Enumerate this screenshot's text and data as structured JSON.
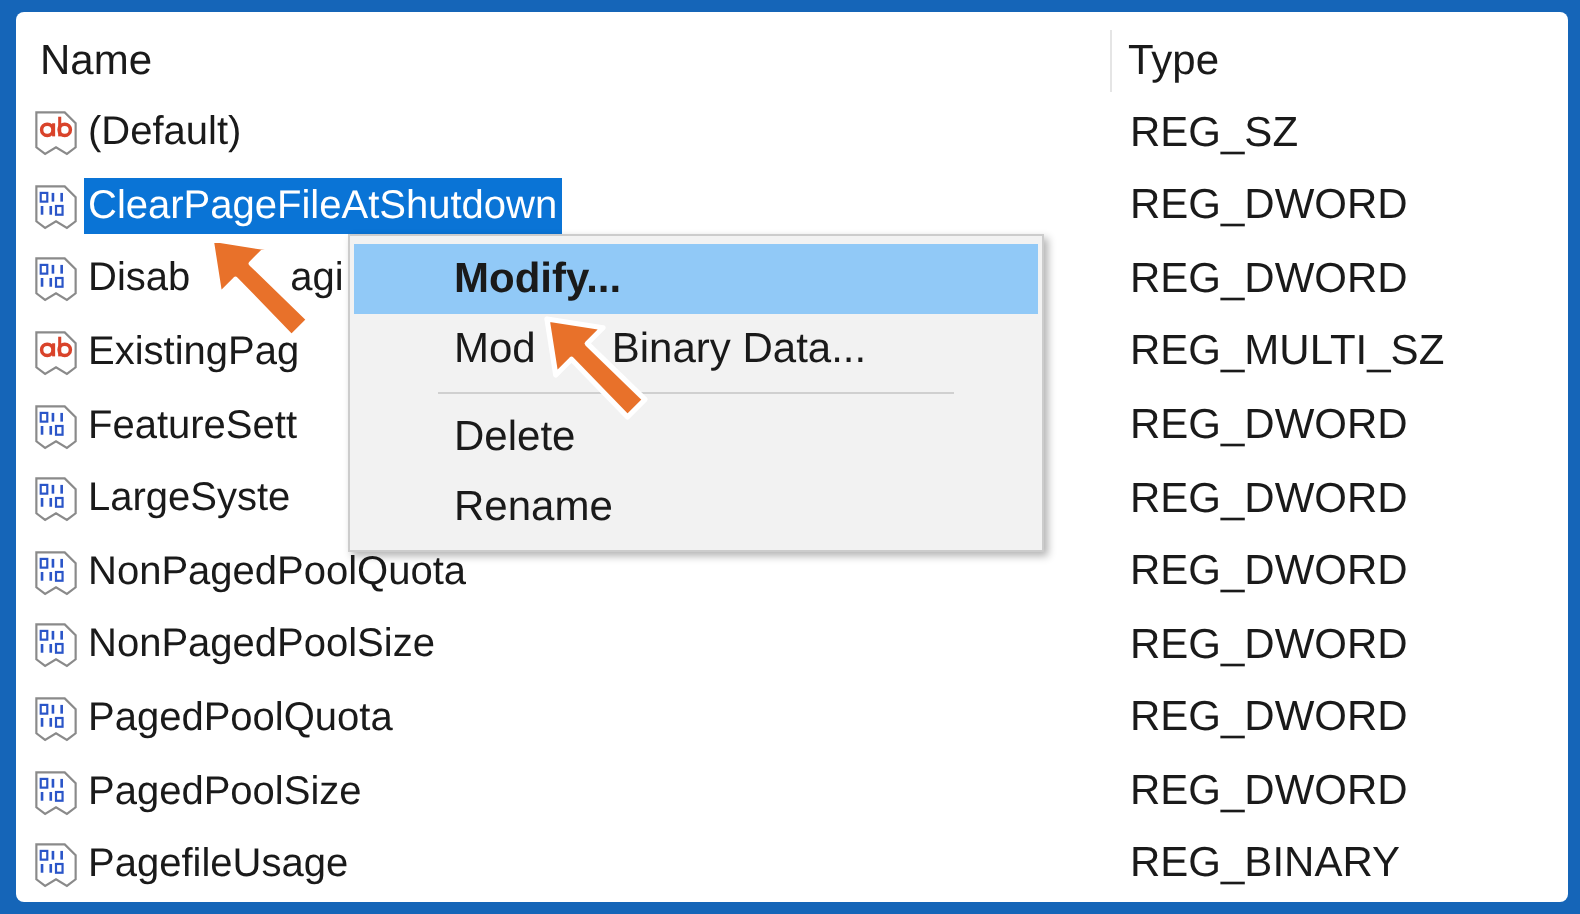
{
  "columns": [
    "Name",
    "Type"
  ],
  "rows": [
    {
      "kind": "string",
      "name": "(Default)",
      "type": "REG_SZ",
      "selected": false
    },
    {
      "kind": "binary",
      "name": "ClearPageFileAtShutdown",
      "type": "REG_DWORD",
      "selected": true
    },
    {
      "kind": "binary",
      "name": "Disab",
      "name_rest": "agi",
      "type": "REG_DWORD",
      "selected": false
    },
    {
      "kind": "string",
      "name": "ExistingPag",
      "type": "REG_MULTI_SZ",
      "selected": false
    },
    {
      "kind": "binary",
      "name": "FeatureSett",
      "type": "REG_DWORD",
      "selected": false
    },
    {
      "kind": "binary",
      "name": "LargeSyste",
      "type": "REG_DWORD",
      "selected": false
    },
    {
      "kind": "binary",
      "name": "NonPagedPoolQuota",
      "type": "REG_DWORD",
      "selected": false
    },
    {
      "kind": "binary",
      "name": "NonPagedPoolSize",
      "type": "REG_DWORD",
      "selected": false
    },
    {
      "kind": "binary",
      "name": "PagedPoolQuota",
      "type": "REG_DWORD",
      "selected": false
    },
    {
      "kind": "binary",
      "name": "PagedPoolSize",
      "type": "REG_DWORD",
      "selected": false
    },
    {
      "kind": "binary",
      "name": "PagefileUsage",
      "type": "REG_BINARY",
      "selected": false
    }
  ],
  "context_menu": {
    "items": [
      {
        "kind": "item",
        "label": "Modify...",
        "selected": true
      },
      {
        "kind": "item",
        "label": "Mod",
        "label_rest": "Binary Data...",
        "selected": false
      },
      {
        "kind": "separator"
      },
      {
        "kind": "item",
        "label": "Delete",
        "selected": false
      },
      {
        "kind": "item",
        "label": "Rename",
        "selected": false
      }
    ]
  }
}
